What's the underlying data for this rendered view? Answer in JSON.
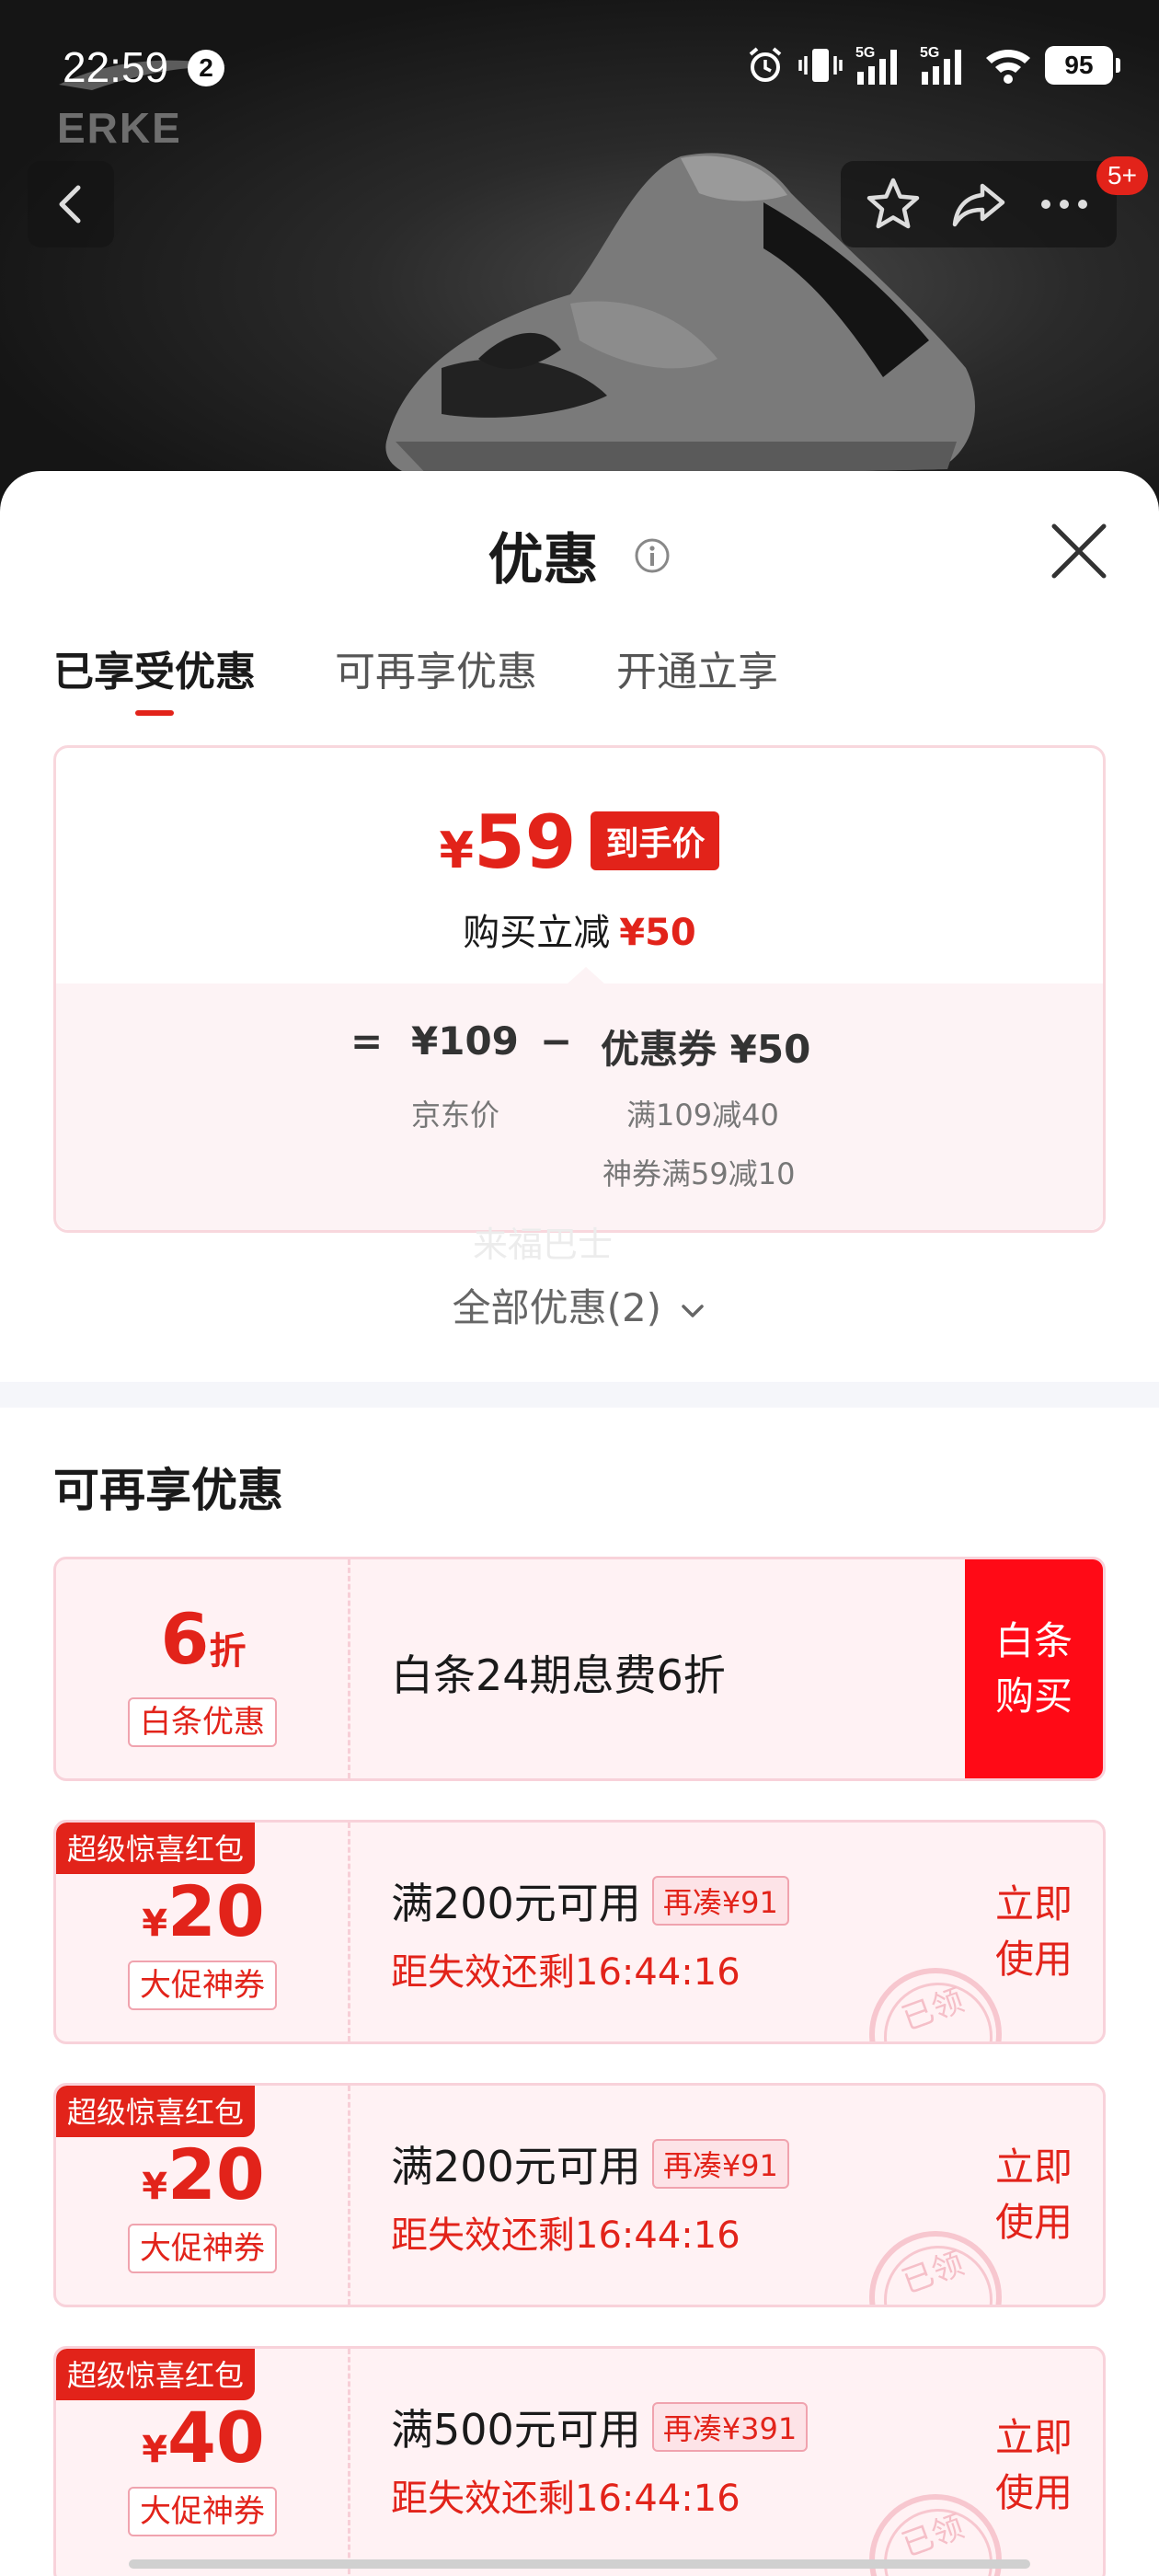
{
  "status_bar": {
    "time": "22:59",
    "notification_count": "2",
    "network_1": "5G",
    "network_2": "5G",
    "battery": "95"
  },
  "hero": {
    "brand": "ERKE",
    "cart_badge": "5+"
  },
  "sheet": {
    "title": "优惠",
    "tabs": [
      {
        "label": "已享受优惠",
        "active": true
      },
      {
        "label": "可再享优惠",
        "active": false
      },
      {
        "label": "开通立享",
        "active": false
      }
    ],
    "summary": {
      "currency": "¥",
      "final_price": "59",
      "price_tag": "到手价",
      "reduce_label": "购买立减",
      "reduce_amount": "¥50",
      "formula": {
        "equals": "=",
        "jd_price": "¥109",
        "minus": "−",
        "coupon_label": "优惠券 ¥50",
        "jd_price_label": "京东价",
        "coupon_detail_1": "满109减40",
        "coupon_detail_2": "神券满59减10"
      }
    },
    "watermark": "来福巴士",
    "all_offers": "全部优惠(2)",
    "section_title": "可再享优惠",
    "offers": [
      {
        "type": "baitiao",
        "big": "6",
        "unit": "折",
        "label": "白条优惠",
        "title": "白条24期息费6折",
        "button_line1": "白条",
        "button_line2": "购买"
      },
      {
        "type": "coupon",
        "flag": "超级惊喜红包",
        "currency": "¥",
        "big": "20",
        "label": "大促神券",
        "title": "满200元可用",
        "chip": "再凑¥91",
        "timer": "距失效还剩16:44:16",
        "button_line1": "立即",
        "button_line2": "使用",
        "stamp": "已领"
      },
      {
        "type": "coupon",
        "flag": "超级惊喜红包",
        "currency": "¥",
        "big": "20",
        "label": "大促神券",
        "title": "满200元可用",
        "chip": "再凑¥91",
        "timer": "距失效还剩16:44:16",
        "button_line1": "立即",
        "button_line2": "使用",
        "stamp": "已领"
      },
      {
        "type": "coupon",
        "flag": "超级惊喜红包",
        "currency": "¥",
        "big": "40",
        "label": "大促神券",
        "title": "满500元可用",
        "chip": "再凑¥391",
        "timer": "距失效还剩16:44:16",
        "button_line1": "立即",
        "button_line2": "使用",
        "stamp": "已领"
      }
    ]
  },
  "colors": {
    "accent": "#e2231a",
    "card_bg": "#fff2f4",
    "card_border": "#f8d2da"
  },
  "icons": [
    "back-icon",
    "star-icon",
    "share-icon",
    "more-icon",
    "info-icon",
    "close-icon",
    "chevron-down-icon",
    "alarm-icon",
    "vibrate-icon",
    "signal-icon",
    "wifi-icon"
  ]
}
